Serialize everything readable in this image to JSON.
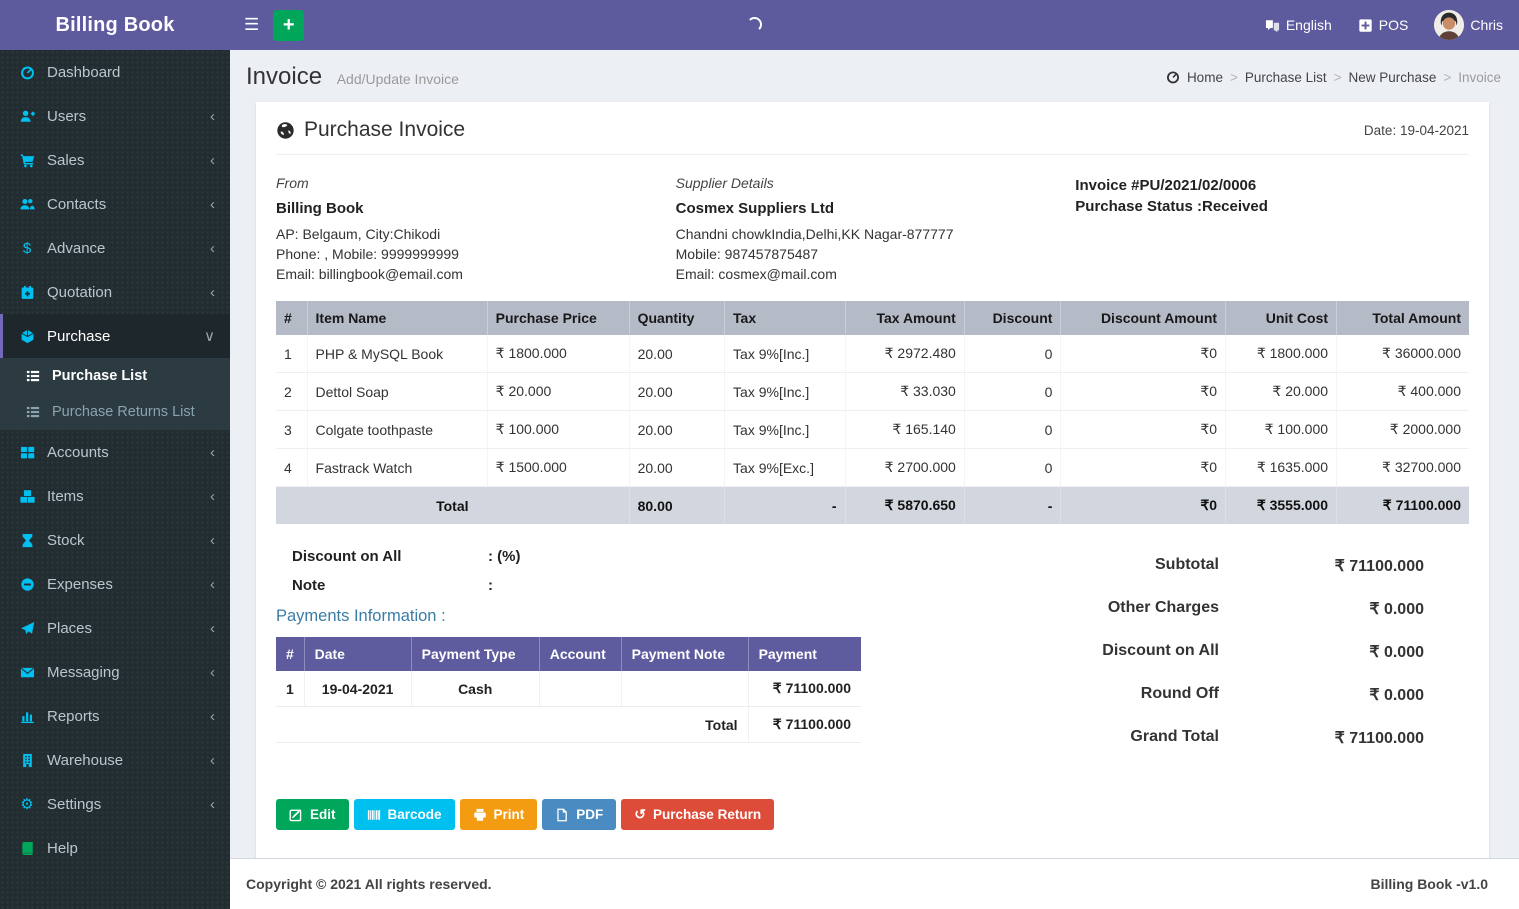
{
  "app": {
    "title": "Billing Book",
    "copyright": "Copyright © 2021 All rights reserved.",
    "version_label": "Billing Book -v1.0"
  },
  "topbar": {
    "language": "English",
    "pos_label": "POS",
    "user_name": "Chris"
  },
  "page_header": {
    "title": "Invoice",
    "subtitle": "Add/Update Invoice",
    "breadcrumb": [
      "Home",
      "Purchase List",
      "New Purchase",
      "Invoice"
    ]
  },
  "sidebar": {
    "items": [
      {
        "label": "Dashboard",
        "icon": "dashboard-icon"
      },
      {
        "label": "Users",
        "icon": "users-icon",
        "chevron": true
      },
      {
        "label": "Sales",
        "icon": "sales-icon",
        "chevron": true
      },
      {
        "label": "Contacts",
        "icon": "contacts-icon",
        "chevron": true
      },
      {
        "label": "Advance",
        "icon": "advance-icon",
        "chevron": true
      },
      {
        "label": "Quotation",
        "icon": "quotation-icon",
        "chevron": true
      },
      {
        "label": "Purchase",
        "icon": "purchase-icon",
        "chevron": true,
        "active": true,
        "open": true,
        "submenu": [
          {
            "label": "Purchase List",
            "icon": "list-icon",
            "active": true
          },
          {
            "label": "Purchase Returns List",
            "icon": "list-icon"
          }
        ]
      },
      {
        "label": "Accounts",
        "icon": "accounts-icon",
        "chevron": true
      },
      {
        "label": "Items",
        "icon": "items-icon",
        "chevron": true
      },
      {
        "label": "Stock",
        "icon": "stock-icon",
        "chevron": true
      },
      {
        "label": "Expenses",
        "icon": "expenses-icon",
        "chevron": true
      },
      {
        "label": "Places",
        "icon": "places-icon",
        "chevron": true
      },
      {
        "label": "Messaging",
        "icon": "messaging-icon",
        "chevron": true
      },
      {
        "label": "Reports",
        "icon": "reports-icon",
        "chevron": true
      },
      {
        "label": "Warehouse",
        "icon": "warehouse-icon",
        "chevron": true
      },
      {
        "label": "Settings",
        "icon": "settings-icon",
        "chevron": true
      },
      {
        "label": "Help",
        "icon": "help-icon",
        "icon_color": "#00a65a"
      }
    ]
  },
  "invoice": {
    "card_title": "Purchase Invoice",
    "date_label": "Date: 19-04-2021",
    "from": {
      "heading": "From",
      "name": "Billing Book",
      "lines": [
        "AP: Belgaum, City:Chikodi",
        "Phone: , Mobile: 9999999999",
        "Email: billingbook@email.com"
      ]
    },
    "supplier": {
      "heading": "Supplier Details",
      "name": "Cosmex Suppliers Ltd",
      "lines": [
        "Chandni chowkIndia,Delhi,KK Nagar-877777",
        "Mobile: 987457875487",
        "Email: cosmex@mail.com"
      ]
    },
    "meta": {
      "invoice_no": "Invoice #PU/2021/02/0006",
      "status": "Purchase Status :Received"
    },
    "items_table": {
      "headers": [
        "#",
        "Item Name",
        "Purchase Price",
        "Quantity",
        "Tax",
        "Tax Amount",
        "Discount",
        "Discount Amount",
        "Unit Cost",
        "Total Amount"
      ],
      "rows": [
        [
          "1",
          "PHP & MySQL Book",
          "₹ 1800.000",
          "20.00",
          "Tax 9%[Inc.]",
          "₹ 2972.480",
          "0",
          "₹0",
          "₹ 1800.000",
          "₹ 36000.000"
        ],
        [
          "2",
          "Dettol Soap",
          "₹ 20.000",
          "20.00",
          "Tax 9%[Inc.]",
          "₹ 33.030",
          "0",
          "₹0",
          "₹ 20.000",
          "₹ 400.000"
        ],
        [
          "3",
          "Colgate toothpaste",
          "₹ 100.000",
          "20.00",
          "Tax 9%[Inc.]",
          "₹ 165.140",
          "0",
          "₹0",
          "₹ 100.000",
          "₹ 2000.000"
        ],
        [
          "4",
          "Fastrack Watch",
          "₹ 1500.000",
          "20.00",
          "Tax 9%[Exc.]",
          "₹ 2700.000",
          "0",
          "₹0",
          "₹ 1635.000",
          "₹ 32700.000"
        ]
      ],
      "total_row": [
        "Total",
        "80.00",
        "-",
        "₹ 5870.650",
        "-",
        "₹0",
        "₹ 3555.000",
        "₹ 71100.000"
      ]
    },
    "discount_on_all": {
      "label": "Discount on All",
      "value": ": (%)"
    },
    "note": {
      "label": "Note",
      "value": ":"
    },
    "payments": {
      "title": "Payments Information :",
      "headers": [
        "#",
        "Date",
        "Payment Type",
        "Account",
        "Payment Note",
        "Payment"
      ],
      "rows": [
        [
          "1",
          "19-04-2021",
          "Cash",
          "",
          "",
          "₹ 71100.000"
        ]
      ],
      "total_label": "Total",
      "total_value": "₹ 71100.000"
    },
    "summary": [
      {
        "label": "Subtotal",
        "value": "₹ 71100.000"
      },
      {
        "label": "Other Charges",
        "value": "₹ 0.000"
      },
      {
        "label": "Discount on All",
        "value": "₹ 0.000"
      },
      {
        "label": "Round Off",
        "value": "₹ 0.000"
      },
      {
        "label": "Grand Total",
        "value": "₹ 71100.000"
      }
    ],
    "actions": [
      {
        "name": "edit-button",
        "label": "Edit",
        "icon": "edit-icon",
        "color": "#00a65a"
      },
      {
        "name": "barcode-button",
        "label": "Barcode",
        "icon": "barcode-icon",
        "color": "#00c0ef"
      },
      {
        "name": "print-button",
        "label": "Print",
        "icon": "print-icon",
        "color": "#f39c12"
      },
      {
        "name": "pdf-button",
        "label": "PDF",
        "icon": "pdf-icon",
        "color": "#4a8bc2"
      },
      {
        "name": "purchase-return-button",
        "label": "Purchase Return",
        "icon": "return-icon",
        "color": "#dd4b39"
      }
    ]
  },
  "colors": {
    "accent_purple": "#5d5a9e",
    "sidebar_dark": "#222d32",
    "sidebar_icon_cyan": "#00c0ef",
    "content_bg": "#ecf0f5",
    "items_header_bg": "#b4bac6",
    "items_total_bg": "#d2d6de",
    "payments_header_bg": "#5e5c9e",
    "green": "#00a65a",
    "cyan": "#00c0ef",
    "orange": "#f39c12",
    "blue": "#4a8bc2",
    "red": "#dd4b39"
  }
}
